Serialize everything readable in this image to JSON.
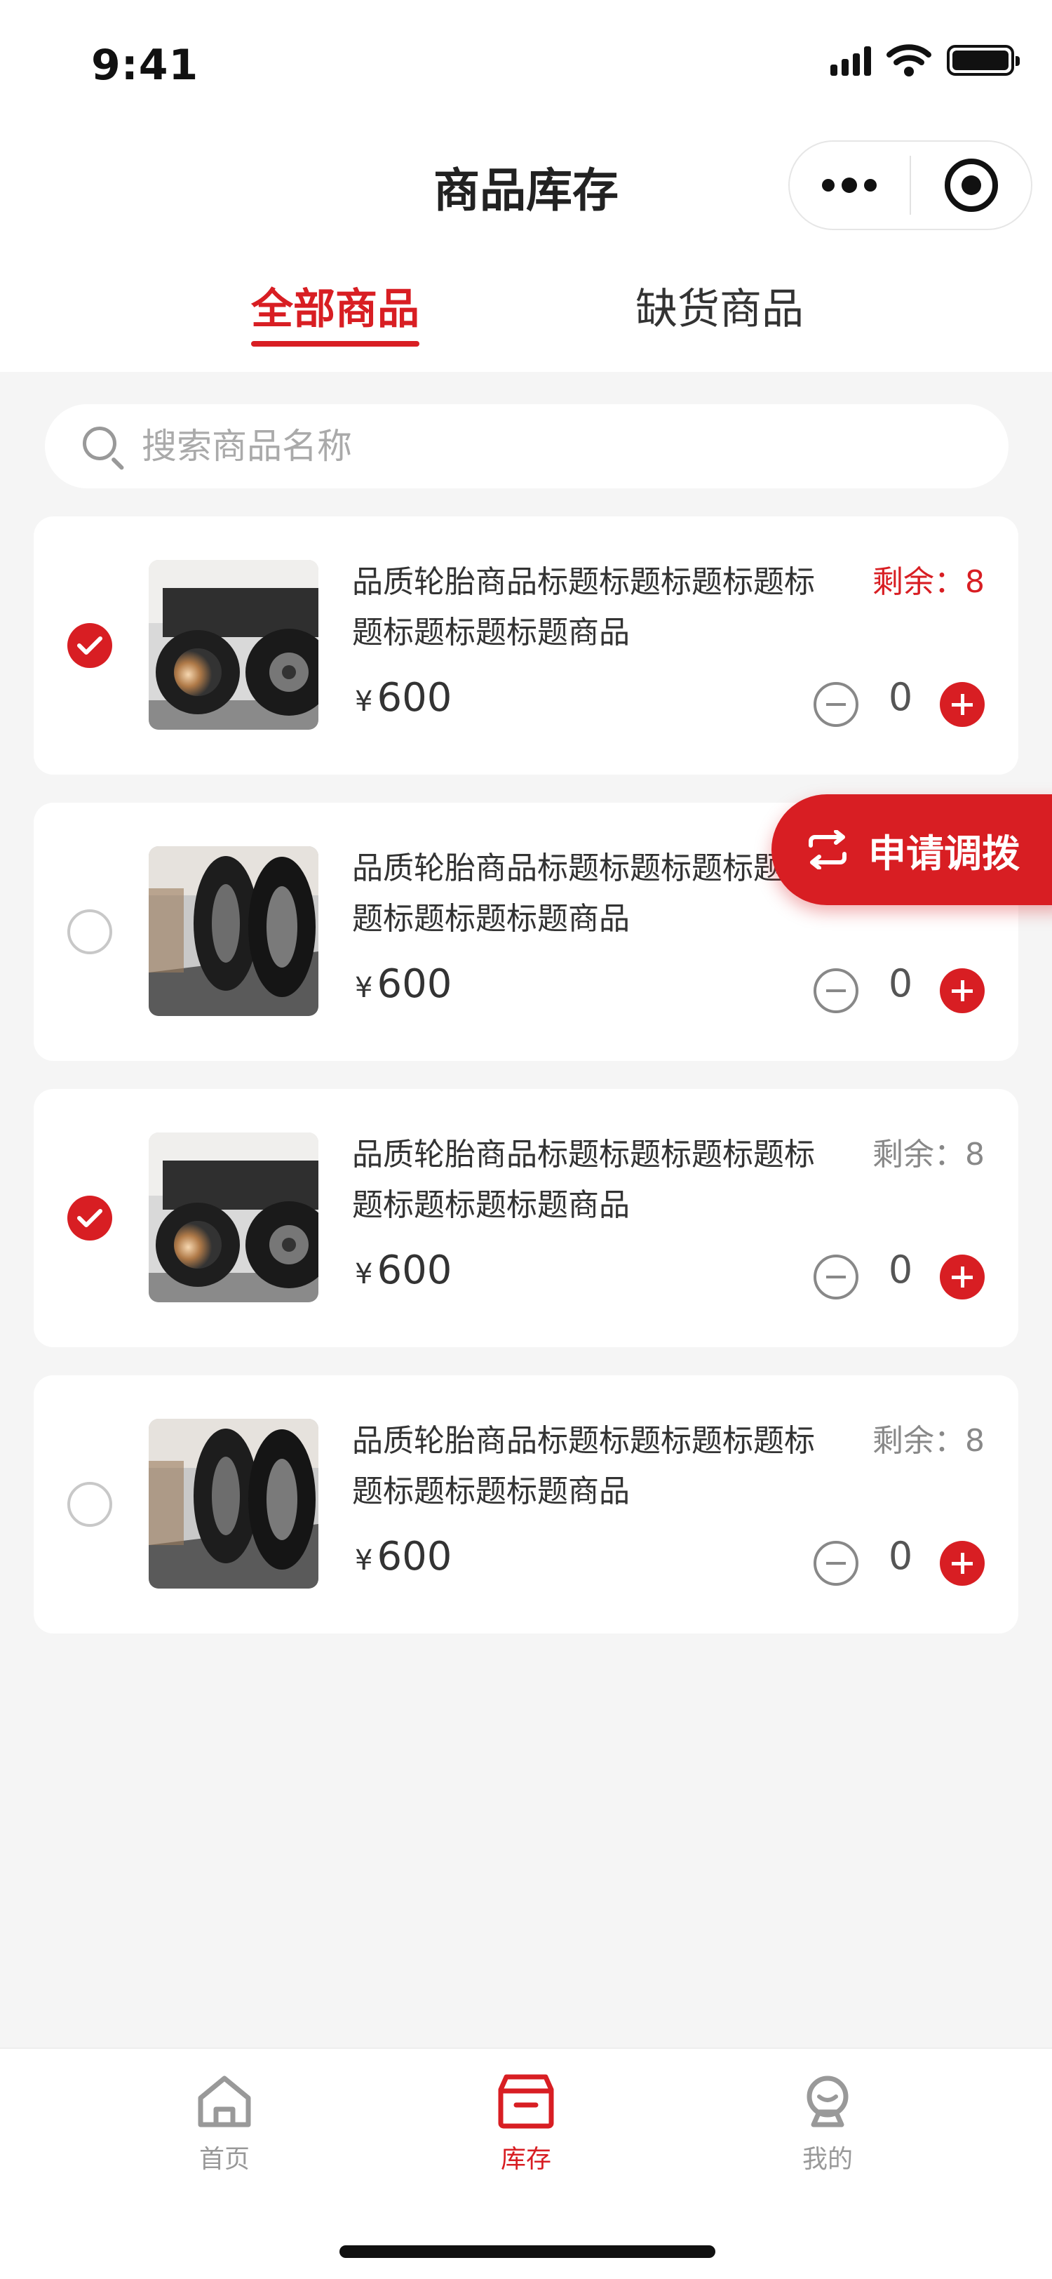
{
  "status_bar": {
    "time": "9:41"
  },
  "nav": {
    "title": "商品库存"
  },
  "tabs": [
    {
      "label": "全部商品",
      "active": true
    },
    {
      "label": "缺货商品",
      "active": false
    }
  ],
  "search": {
    "placeholder": "搜索商品名称",
    "value": ""
  },
  "products": [
    {
      "title": "品质轮胎商品标题标题标题标题标题标题标题标题商品",
      "remain_label": "剩余：8",
      "remain_color": "#d81e23",
      "currency": "¥",
      "price": "600",
      "qty": "0",
      "checked": true
    },
    {
      "title": "品质轮胎商品标题标题标题标题标题标题标题标题商品",
      "remain_label": "",
      "currency": "¥",
      "price": "600",
      "qty": "0",
      "checked": false
    },
    {
      "title": "品质轮胎商品标题标题标题标题标题标题标题标题商品",
      "remain_label": "剩余：8",
      "remain_color": "#888888",
      "currency": "¥",
      "price": "600",
      "qty": "0",
      "checked": true
    },
    {
      "title": "品质轮胎商品标题标题标题标题标题标题标题标题商品",
      "remain_label": "剩余：8",
      "remain_color": "#888888",
      "currency": "¥",
      "price": "600",
      "qty": "0",
      "checked": false
    }
  ],
  "float_button": {
    "label": "申请调拨",
    "icon": "transfer-arrows-icon"
  },
  "tabbar": [
    {
      "label": "首页",
      "icon": "home-icon",
      "active": false
    },
    {
      "label": "库存",
      "icon": "inventory-box-icon",
      "active": true
    },
    {
      "label": "我的",
      "icon": "profile-icon",
      "active": false
    }
  ],
  "colors": {
    "accent": "#d81e23",
    "background": "#f5f5f5"
  }
}
